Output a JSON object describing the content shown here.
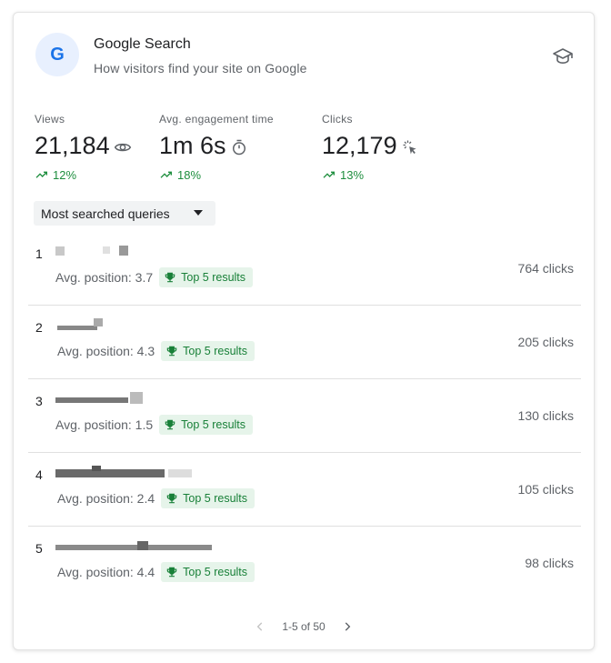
{
  "header": {
    "logo_letter": "G",
    "title": "Google Search",
    "subtitle": "How visitors find your site on Google"
  },
  "metrics": [
    {
      "label": "Views",
      "value": "21,184",
      "icon": "eye-icon",
      "change": "12%"
    },
    {
      "label": "Avg. engagement time",
      "value": "1m 6s",
      "icon": "timer-icon",
      "change": "18%"
    },
    {
      "label": "Clicks",
      "value": "12,179",
      "icon": "click-icon",
      "change": "13%"
    }
  ],
  "dropdown": {
    "selected": "Most searched queries"
  },
  "queries": [
    {
      "rank": "1",
      "position": "Avg. position: 3.7",
      "badge": "Top 5 results",
      "clicks": "764 clicks"
    },
    {
      "rank": "2",
      "position": "Avg. position: 4.3",
      "badge": "Top 5 results",
      "clicks": "205 clicks"
    },
    {
      "rank": "3",
      "position": "Avg. position: 1.5",
      "badge": "Top 5 results",
      "clicks": "130 clicks"
    },
    {
      "rank": "4",
      "position": "Avg. position: 2.4",
      "badge": "Top 5 results",
      "clicks": "105 clicks"
    },
    {
      "rank": "5",
      "position": "Avg. position: 4.4",
      "badge": "Top 5 results",
      "clicks": "98 clicks"
    }
  ],
  "pager": {
    "text": "1-5 of 50"
  },
  "colors": {
    "accent": "#1a73e8",
    "positive": "#1e8e3e",
    "badge_bg": "#e6f4ea",
    "badge_text": "#188038"
  }
}
